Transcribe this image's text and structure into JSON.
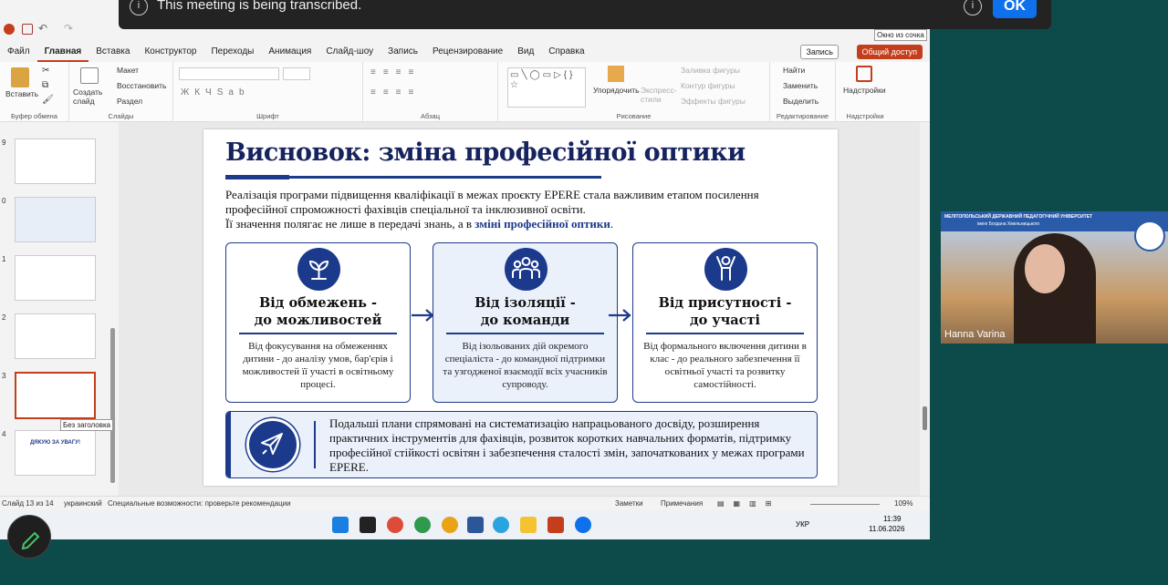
{
  "banner": {
    "text": "This meeting is being transcribed.",
    "ok": "OK",
    "info_icon": "info-icon"
  },
  "tooltips": {
    "window_mode": "Окно из сочка",
    "no_title": "Без заголовка"
  },
  "menu": [
    "Файл",
    "Главная",
    "Вставка",
    "Конструктор",
    "Переходы",
    "Анимация",
    "Слайд-шоу",
    "Запись",
    "Рецензирование",
    "Вид",
    "Справка"
  ],
  "menu_active": "Главная",
  "record_button": "Запись",
  "share_button": "Общий доступ",
  "ribbon": {
    "paste": "Вставить",
    "clipboard": "Буфер обмена",
    "create_slide": "Создать слайд",
    "layout": "Макет",
    "reset": "Восстановить",
    "section": "Раздел",
    "slides": "Слайды",
    "font": "Шрифт",
    "paragraph": "Абзац",
    "arrange": "Упорядочить",
    "express_styles": "Экспресс-стили",
    "shape_fill": "Заливка фигуры",
    "shape_outline": "Контур фигуры",
    "shape_effects": "Эффекты фигуры",
    "drawing": "Рисование",
    "find": "Найти",
    "replace": "Заменить",
    "select": "Выделить",
    "editing": "Редактирование",
    "designer": "Надстройки",
    "addins": "Надстройки"
  },
  "thumbnails": [
    {
      "num": "9"
    },
    {
      "num": "0"
    },
    {
      "num": "1"
    },
    {
      "num": "2"
    },
    {
      "num": "3"
    },
    {
      "num": "4",
      "text": "ДЯКУЮ ЗА УВАГУ!"
    }
  ],
  "slide": {
    "title": "Висновок: зміна професійної оптики",
    "intro_1": "Реалізація програми підвищення кваліфікації в межах проєкту EPERE стала важливим етапом посилення професійної спроможності фахівців спеціальної та інклюзивної освіти.",
    "intro_2": "Її значення полягає не лише в передачі знань, а в ",
    "intro_hl": "зміні професійної оптики",
    "intro_end": ".",
    "cards": [
      {
        "icon": "sprout-icon",
        "title_1": "Від обмежень -",
        "title_2": "до можливостей",
        "desc": "Від фокусування на обмеженнях дитини - до аналізу умов, бар'єрів і можливостей її участі в освітньому процесі."
      },
      {
        "icon": "team-icon",
        "title_1": "Від ізоляції -",
        "title_2": "до команди",
        "desc": "Від ізольованих дій окремого спеціаліста - до командної підтримки та узгодженої взаємодії всіх учасників супроводу."
      },
      {
        "icon": "raised-arms-icon",
        "title_1": "Від присутності -",
        "title_2": "до участі",
        "desc": "Від формального включення дитини в клас - до реального забезпечення її освітньої участі та розвитку самостійності."
      }
    ],
    "bottom_icon": "paper-plane-icon",
    "bottom_text": "Подальші плани спрямовані на систематизацію напрацьованого досвіду, розширення практичних інструментів для фахівців, розвиток коротких навчальних форматів, підтримку професійної стійкості освітян і забезпечення сталості змін, започаткованих у межах програми EPERE."
  },
  "status": {
    "slide_of": "Слайд 13 из 14",
    "language": "украинский",
    "accessibility": "Специальные возможности: проверьте рекомендации",
    "notes": "Заметки",
    "comments": "Примечания",
    "zoom": "109%"
  },
  "taskbar": {
    "lang": "УКР",
    "time": "11:39",
    "date": "11.06.2026"
  },
  "video": {
    "name": "Hanna Varina",
    "header": "МЕЛІТОПОЛЬСЬКИЙ ДЕРЖАВНИЙ ПЕДАГОГІЧНИЙ УНІВЕРСИТЕТ",
    "subheader": "імені Богдана Хмельницького"
  },
  "colors": {
    "navy": "#1e3a8a",
    "accent": "#c43e1c",
    "zoom_blue": "#0e71eb"
  }
}
